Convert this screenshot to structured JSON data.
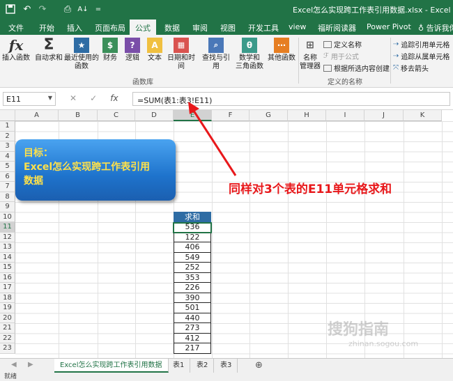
{
  "titlebar": {
    "doc_title": "Excel怎么实现跨工作表引用数据.xlsx - Excel",
    "save_icon": "save-icon",
    "undo_icon": "undo-icon",
    "redo_icon": "redo-icon"
  },
  "tabs": [
    "文件",
    "开始",
    "插入",
    "页面布局",
    "公式",
    "数据",
    "审阅",
    "视图",
    "开发工具",
    "view",
    "福昕阅读器",
    "Power Pivot",
    "告诉我你"
  ],
  "active_tab": "公式",
  "ribbon": {
    "insert_function": "插入函数",
    "autosum": "自动求和",
    "recent_1": "最近使用的",
    "recent_2": "函数",
    "finance": "财务",
    "logic": "逻辑",
    "text": "文本",
    "datetime": "日期和时间",
    "lookup": "查找与引用",
    "math_1": "数学和",
    "math_2": "三角函数",
    "other": "其他函数",
    "function_library": "函数库",
    "name_mgr_1": "名称",
    "name_mgr_2": "管理器",
    "define_name": "定义名称",
    "use_in_formula": "用于公式",
    "create_from_sel": "根据所选内容创建",
    "defined_names": "定义的名称",
    "trace_precedents": "追踪引用单元格",
    "trace_dependents": "追踪从属单元格",
    "remove_arrows": "移去箭头"
  },
  "formula_bar": {
    "name_box": "E11",
    "formula": "=SUM(表1:表3!E11)",
    "cancel_icon": "✕",
    "enter_icon": "✓",
    "fx_icon": "fx"
  },
  "columns": [
    "A",
    "B",
    "C",
    "D",
    "E",
    "F",
    "G",
    "H",
    "I",
    "J",
    "K"
  ],
  "rows": [
    "1",
    "2",
    "3",
    "4",
    "5",
    "6",
    "7",
    "8",
    "9",
    "10",
    "11",
    "12",
    "13",
    "14",
    "15",
    "16",
    "17",
    "18",
    "19",
    "20",
    "21",
    "22",
    "23"
  ],
  "goal_box": {
    "line1": "目标：",
    "line2": "Excel怎么实现跨工作表引用",
    "line3": "数据"
  },
  "annotation": "同样对3个表的E11单元格求和",
  "table": {
    "header": "求和",
    "values": [
      "536",
      "122",
      "406",
      "549",
      "252",
      "353",
      "226",
      "390",
      "501",
      "440",
      "273",
      "412",
      "217"
    ]
  },
  "sheet_tabs": [
    "Excel怎么实现跨工作表引用数据",
    "表1",
    "表2",
    "表3"
  ],
  "status": "就绪",
  "watermark": {
    "text": "搜狗指南",
    "url": "zhinan.sogou.com"
  },
  "colors": {
    "excel_green": "#217346",
    "header_blue": "#2e6ca4",
    "annotation_red": "#e8181b",
    "goal_text": "#ffe14a"
  }
}
